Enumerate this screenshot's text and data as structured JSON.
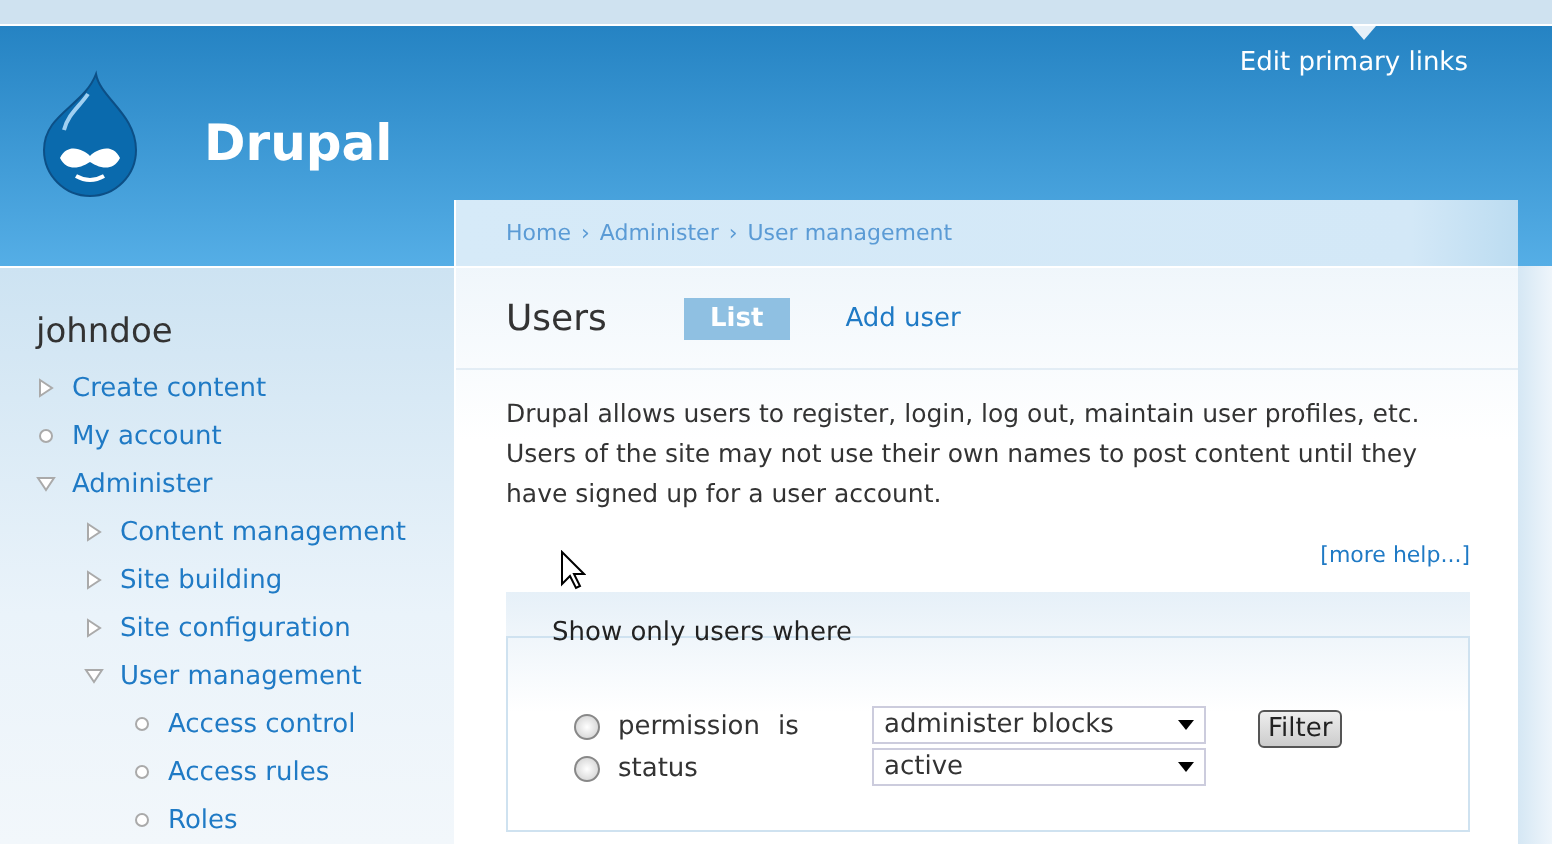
{
  "header": {
    "site_name": "Drupal",
    "edit_link": "Edit primary links"
  },
  "sidebar": {
    "user": "johndoe",
    "items": [
      {
        "label": "Create content",
        "kind": "branch",
        "expanded": false
      },
      {
        "label": "My account",
        "kind": "leaf"
      },
      {
        "label": "Administer",
        "kind": "branch",
        "expanded": true,
        "children": [
          {
            "label": "Content management",
            "kind": "branch",
            "expanded": false
          },
          {
            "label": "Site building",
            "kind": "branch",
            "expanded": false
          },
          {
            "label": "Site configuration",
            "kind": "branch",
            "expanded": false
          },
          {
            "label": "User management",
            "kind": "branch",
            "expanded": true,
            "children": [
              {
                "label": "Access control",
                "kind": "leaf"
              },
              {
                "label": "Access rules",
                "kind": "leaf"
              },
              {
                "label": "Roles",
                "kind": "leaf"
              }
            ]
          }
        ]
      }
    ]
  },
  "breadcrumb": [
    "Home",
    "Administer",
    "User management"
  ],
  "breadcrumb_separator": "›",
  "page_title": "Users",
  "tabs": [
    {
      "label": "List",
      "selected": true
    },
    {
      "label": "Add user",
      "selected": false
    }
  ],
  "description": "Drupal allows users to register, login, log out, maintain user profiles, etc. Users of the site may not use their own names to post content until they have signed up for a user account.",
  "more_help": "[more help...]",
  "filter": {
    "legend": "Show only users where",
    "is_label": "is",
    "rows": [
      {
        "label": "permission",
        "selected": false,
        "value": "administer blocks"
      },
      {
        "label": "status",
        "selected": false,
        "value": "active"
      }
    ],
    "button": "Filter"
  }
}
